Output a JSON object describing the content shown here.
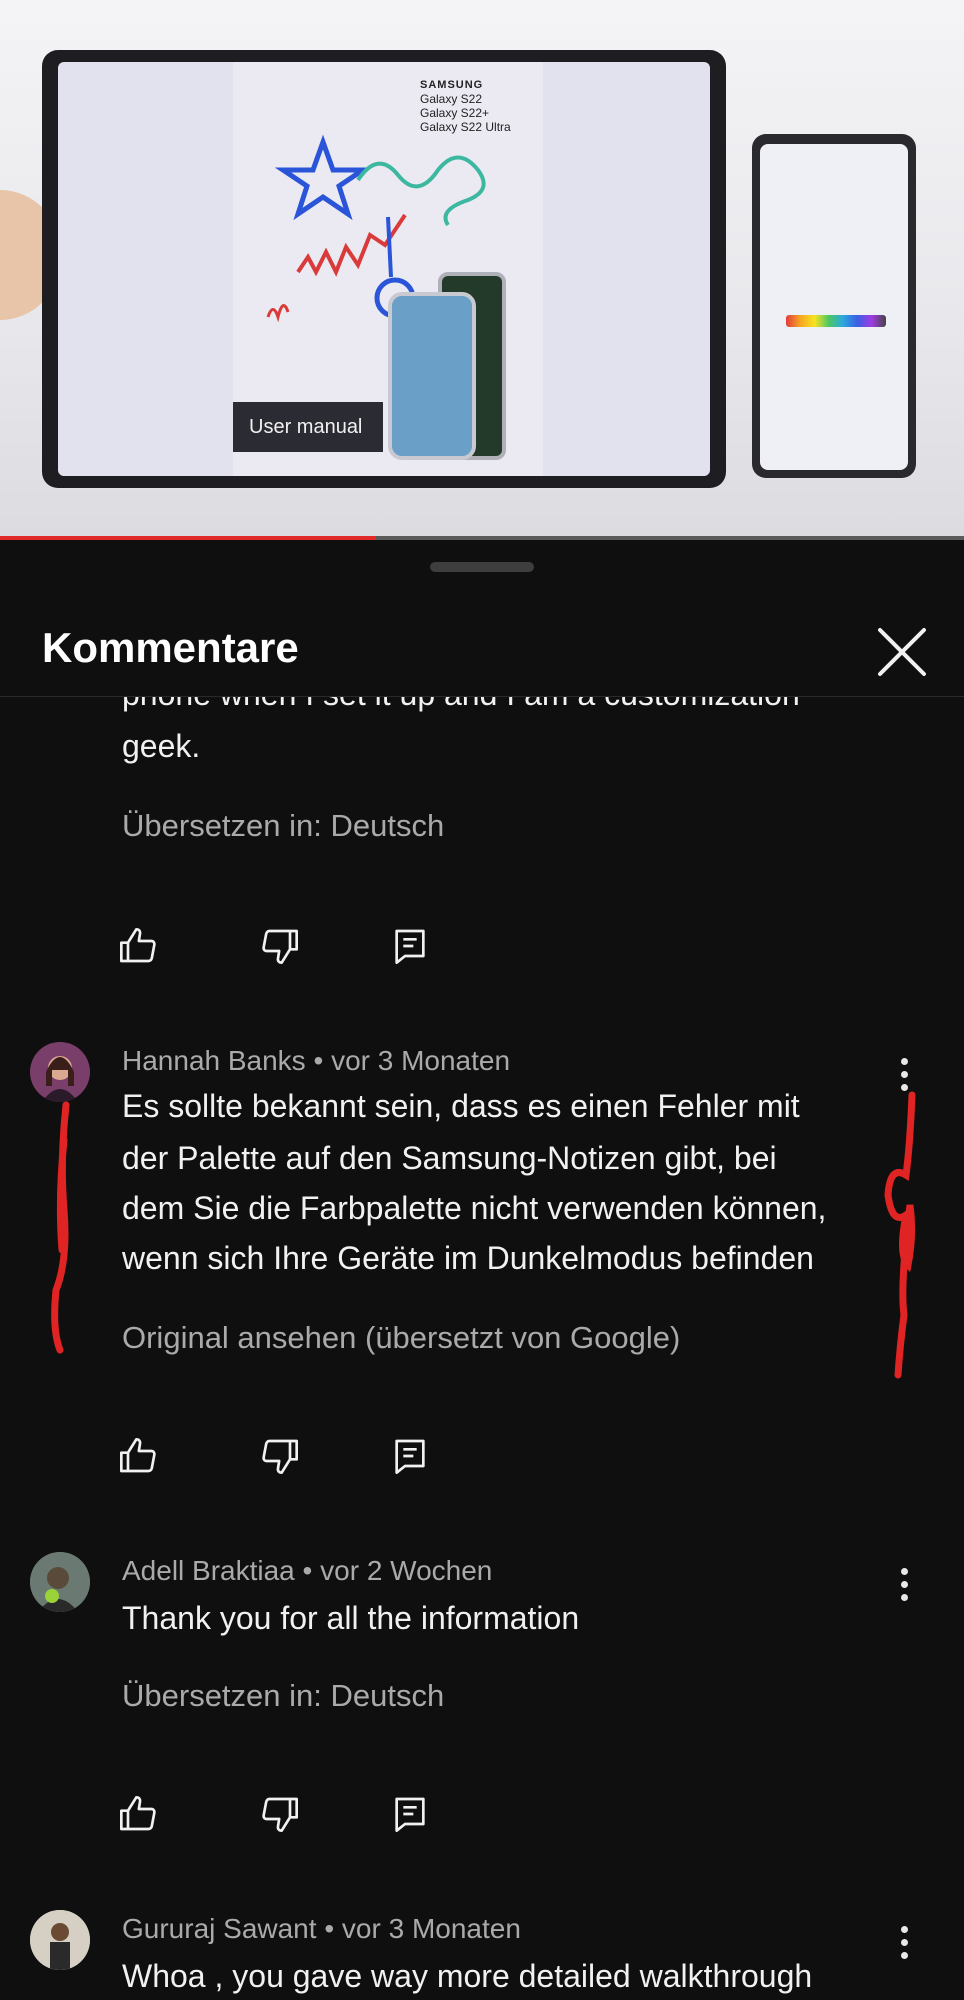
{
  "video": {
    "brand": "SAMSUNG",
    "models": [
      "Galaxy S22",
      "Galaxy S22+",
      "Galaxy S22 Ultra"
    ],
    "banner": "User manual",
    "progress": 0.39
  },
  "sheet": {
    "title": "Kommentare"
  },
  "comments": [
    {
      "text_lines": [
        "phone when I set it up and I am a customization",
        "geek."
      ],
      "action_link": "Übersetzen in: Deutsch"
    },
    {
      "author": "Hannah Banks",
      "time": "vor 3 Monaten",
      "text_lines": [
        "Es sollte bekannt sein, dass es einen Fehler mit",
        "der Palette auf den Samsung-Notizen gibt, bei",
        "dem Sie die Farbpalette nicht verwenden können,",
        "wenn sich Ihre Geräte im Dunkelmodus befinden"
      ],
      "action_link": "Original ansehen (übersetzt von Google)",
      "avatar_color": "#7a3e6a"
    },
    {
      "author": "Adell Braktiaa",
      "time": "vor 2 Wochen",
      "text_lines": [
        "Thank you for all the information"
      ],
      "action_link": "Übersetzen in: Deutsch",
      "avatar_color": "#4a5a4a"
    },
    {
      "author": "Gururaj Sawant",
      "time": "vor 3 Monaten",
      "text_lines": [
        "Whoa , you gave way more detailed walkthrough"
      ],
      "avatar_color": "#c8c2b6"
    }
  ],
  "meta_separator": "•",
  "icons": [
    "like-icon",
    "dislike-icon",
    "reply-icon",
    "more-icon",
    "close-icon"
  ],
  "colors": {
    "background": "#0f0f0f",
    "text": "#f1f1f1",
    "secondary": "#aaaaaa",
    "annotation": "#e02424"
  }
}
